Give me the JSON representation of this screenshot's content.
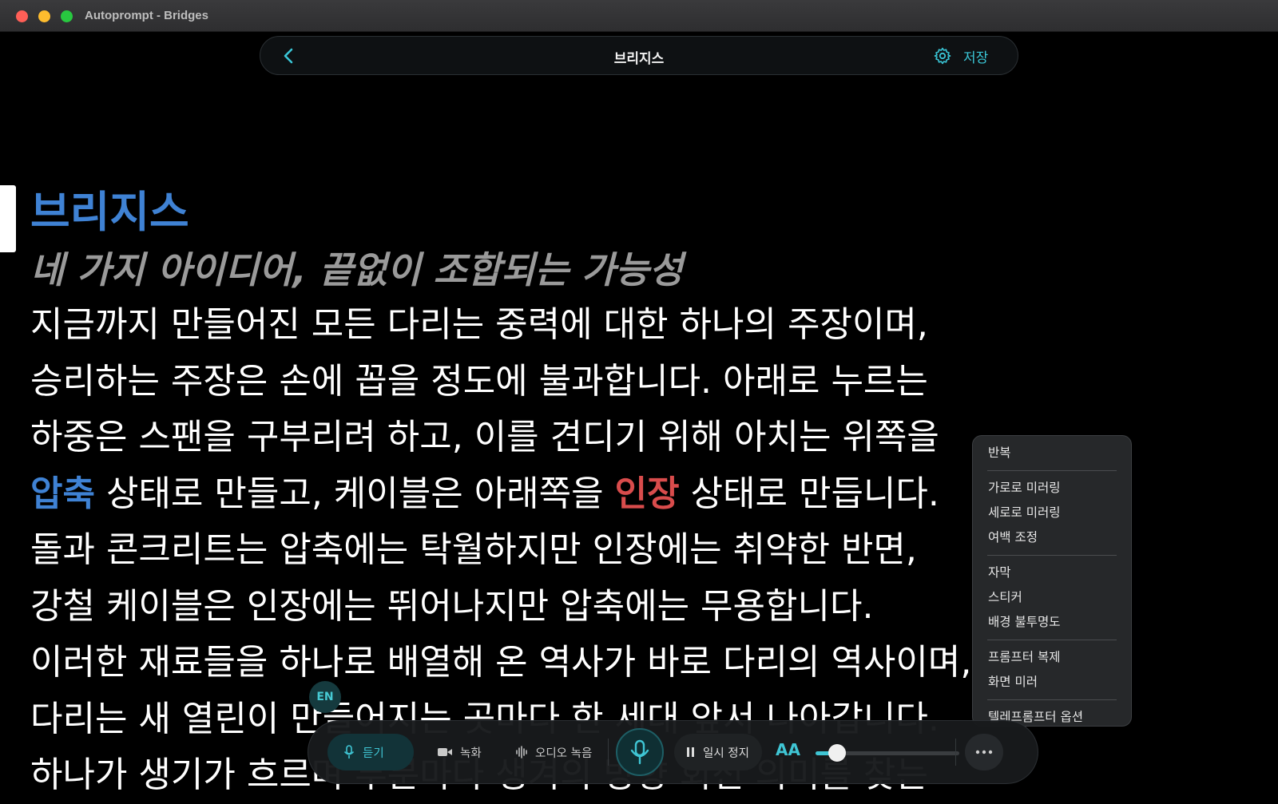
{
  "window": {
    "title": "Autoprompt - Bridges"
  },
  "header": {
    "title": "브리지스",
    "save_label": "저장"
  },
  "script": {
    "heading": "브리지스",
    "subtitle": "네 가지 아이디어, 끝없이 조합되는 가능성",
    "line1": "지금까지 만들어진 모든 다리는 중력에 대한 하나의 주장이며,",
    "line2": "승리하는 주장은 손에 꼽을 정도에 불과합니다. 아래로 누르는",
    "line3": "하중은 스팬을 구부리려 하고, 이를 견디기 위해 아치는 위쪽을",
    "line4_a": "압축",
    "line4_b": " 상태로 만들고, 케이블은 아래쪽을 ",
    "line4_c": "인장",
    "line4_d": " 상태로 만듭니다.",
    "line5": "돌과 콘크리트는 압축에는 탁월하지만 인장에는 취약한 반면,",
    "line6": "강철 케이블은 인장에는 뛰어나지만 압축에는 무용합니다.",
    "line7": "이러한 재료들을 하나로 배열해 온 역사가 바로 다리의 역사이며,",
    "line8": "다리는 새 열린이 만들어지는 곳마다 한 세대 앞서 나아갑니다.",
    "line9": "하나가 생기가 흐르며 부분마다 생겨의 방향 회전 의미를 찾는"
  },
  "menu": {
    "items": [
      "반복",
      "가로로 미러링",
      "세로로 미러링",
      "여백 조정",
      "자막",
      "스티커",
      "배경 불투명도",
      "프롬프터 복제",
      "화면 미러",
      "텔레프롬프터 옵션"
    ]
  },
  "language_badge": "EN",
  "controls": {
    "listen_label": "듣기",
    "video_label": "녹화",
    "audio_label": "오디오 녹음",
    "pause_label": "일시 정지",
    "font_size_label": "AA",
    "speed_value": 0.15
  },
  "colors": {
    "accent": "#3fc5d4",
    "heading_blue": "#3f82d4",
    "emphasis_red": "#d94c4c"
  },
  "icons": [
    "back-chevron-icon",
    "gear-icon",
    "microphone-icon",
    "video-camera-icon",
    "waveform-icon",
    "pause-icon",
    "more-dots-icon"
  ]
}
